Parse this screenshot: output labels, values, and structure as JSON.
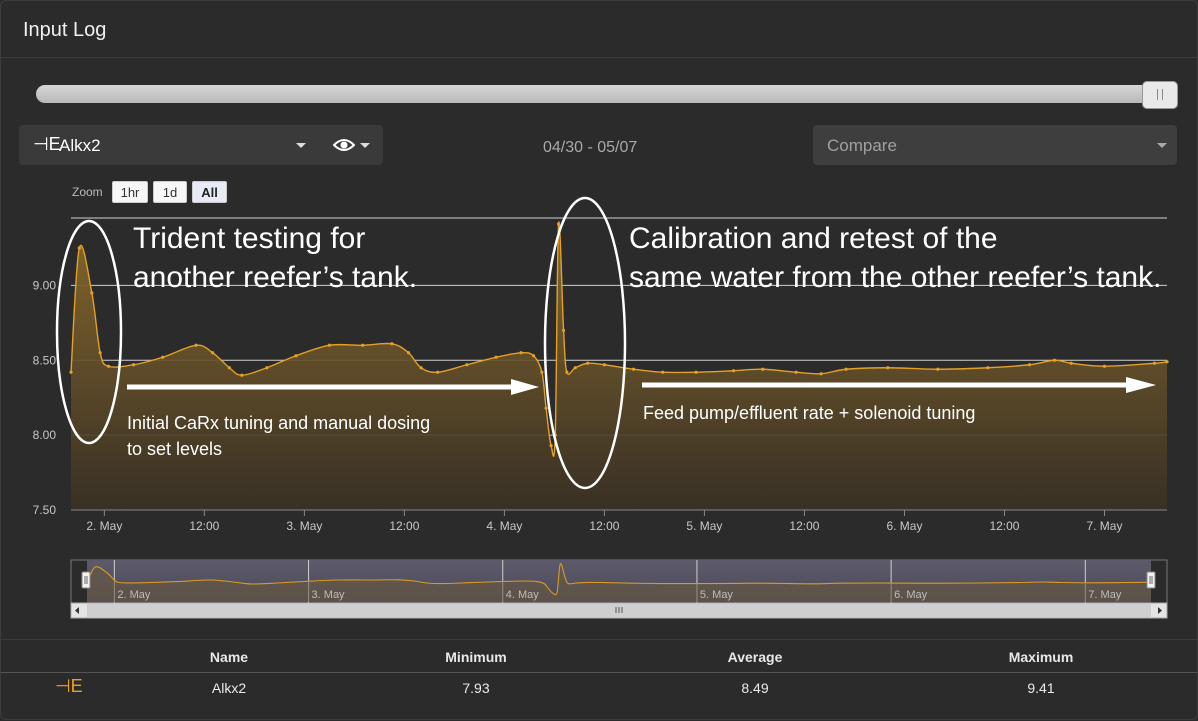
{
  "header": {
    "title": "Input Log"
  },
  "range_slider": {
    "position": 1.0
  },
  "parameter": {
    "icon": "alk-icon",
    "label": "Alkx2"
  },
  "visibility": {
    "icon": "eye-icon"
  },
  "date_range": "04/30 - 05/07",
  "compare": {
    "placeholder": "Compare"
  },
  "zoom": {
    "label": "Zoom",
    "buttons": [
      "1hr",
      "1d",
      "All"
    ],
    "active": "All"
  },
  "colors": {
    "series": "#e3a127",
    "fill_top": "#8a6a2c",
    "background": "#2b2b2b",
    "annotation": "#ffffff"
  },
  "annotations": {
    "left_title": [
      "Trident testing for",
      "another reefer’s tank."
    ],
    "right_title": [
      "Calibration and retest of the",
      "same water from the other reefer’s tank."
    ],
    "left_caption": [
      "Initial CaRx tuning and manual dosing",
      "to set levels"
    ],
    "right_caption": "Feed pump/effluent rate + solenoid tuning"
  },
  "chart_data": {
    "type": "area",
    "ylim": [
      7.5,
      9.45
    ],
    "y_ticks": [
      "7.50",
      "8.00",
      "8.50",
      "9.00"
    ],
    "x_ticks": [
      "2. May",
      "12:00",
      "3. May",
      "12:00",
      "4. May",
      "12:00",
      "5. May",
      "12:00",
      "6. May",
      "12:00",
      "7. May"
    ],
    "x_tick_hours": [
      24,
      36,
      48,
      60,
      72,
      84,
      96,
      108,
      120,
      132,
      144
    ],
    "navigator_ticks": [
      "2. May",
      "3. May",
      "4. May",
      "5. May",
      "6. May",
      "7. May"
    ],
    "navigator_tick_hours": [
      24,
      48,
      72,
      96,
      120,
      144
    ],
    "series": [
      {
        "name": "Alkx2",
        "points": [
          [
            20.0,
            8.42
          ],
          [
            21.0,
            9.25
          ],
          [
            22.5,
            8.95
          ],
          [
            23.5,
            8.55
          ],
          [
            24.5,
            8.46
          ],
          [
            27.5,
            8.47
          ],
          [
            31.0,
            8.52
          ],
          [
            35.0,
            8.6
          ],
          [
            37.0,
            8.55
          ],
          [
            39.0,
            8.45
          ],
          [
            40.5,
            8.4
          ],
          [
            43.5,
            8.45
          ],
          [
            47.0,
            8.53
          ],
          [
            51.0,
            8.6
          ],
          [
            55.0,
            8.6
          ],
          [
            58.5,
            8.61
          ],
          [
            60.5,
            8.55
          ],
          [
            62.0,
            8.45
          ],
          [
            64.0,
            8.42
          ],
          [
            67.5,
            8.47
          ],
          [
            71.0,
            8.52
          ],
          [
            74.0,
            8.55
          ],
          [
            75.5,
            8.53
          ],
          [
            76.5,
            8.42
          ],
          [
            77.0,
            8.18
          ],
          [
            77.6,
            7.93
          ],
          [
            78.1,
            8.0
          ],
          [
            78.5,
            9.41
          ],
          [
            79.1,
            8.7
          ],
          [
            79.5,
            8.42
          ],
          [
            80.5,
            8.45
          ],
          [
            82.0,
            8.48
          ],
          [
            84.0,
            8.47
          ],
          [
            87.5,
            8.44
          ],
          [
            91.0,
            8.42
          ],
          [
            95.0,
            8.42
          ],
          [
            99.5,
            8.43
          ],
          [
            103.0,
            8.44
          ],
          [
            107.0,
            8.42
          ],
          [
            110.0,
            8.41
          ],
          [
            113.0,
            8.44
          ],
          [
            118.0,
            8.45
          ],
          [
            124.0,
            8.44
          ],
          [
            130.0,
            8.45
          ],
          [
            135.0,
            8.47
          ],
          [
            138.0,
            8.5
          ],
          [
            140.0,
            8.48
          ],
          [
            144.0,
            8.46
          ],
          [
            150.0,
            8.48
          ],
          [
            151.5,
            8.49
          ]
        ]
      }
    ]
  },
  "stats": {
    "columns": [
      "Name",
      "Minimum",
      "Average",
      "Maximum"
    ],
    "row": {
      "icon": "alk-icon",
      "name": "Alkx2",
      "minimum": "7.93",
      "average": "8.49",
      "maximum": "9.41"
    }
  }
}
